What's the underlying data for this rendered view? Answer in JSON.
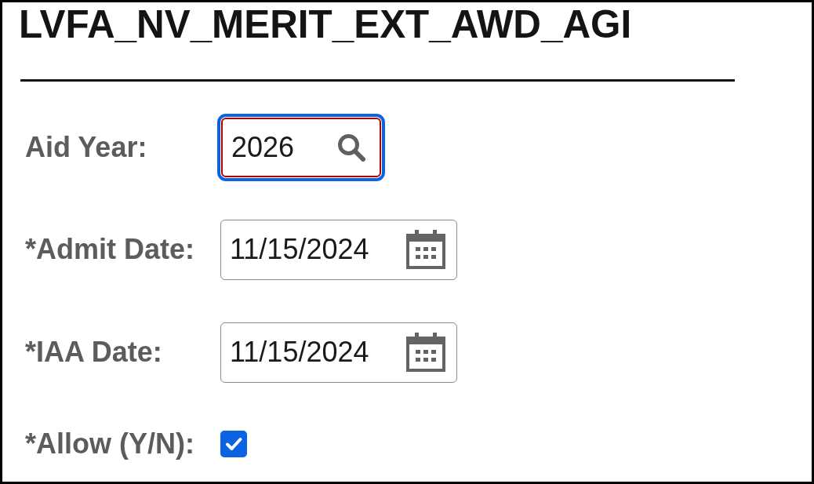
{
  "title": "LVFA_NV_MERIT_EXT_AWD_AGI",
  "fields": [
    {
      "kind": "lookup",
      "label": "Aid Year:",
      "value": "2026",
      "focused": true,
      "invalid": true
    },
    {
      "kind": "date",
      "label": "*Admit Date:",
      "value": "11/15/2024",
      "focused": false,
      "invalid": false
    },
    {
      "kind": "date",
      "label": "*IAA Date:",
      "value": "11/15/2024",
      "focused": false,
      "invalid": false
    },
    {
      "kind": "checkbox",
      "label": "*Allow (Y/N):",
      "checked": true,
      "focused": false,
      "invalid": false
    }
  ]
}
